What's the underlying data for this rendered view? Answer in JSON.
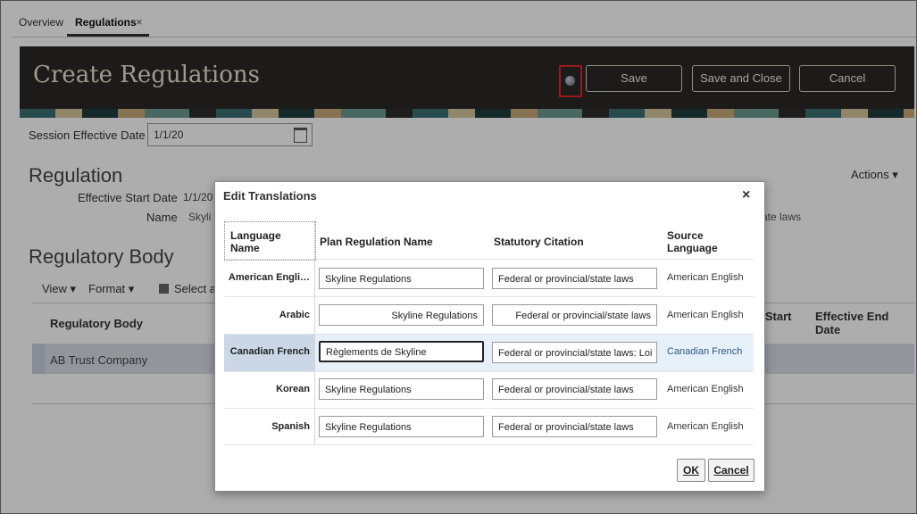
{
  "tabs": [
    {
      "label": "Overview"
    },
    {
      "label": "Regulations"
    }
  ],
  "header": {
    "title": "Create Regulations",
    "buttons": {
      "save": "Save",
      "save_close": "Save and Close",
      "cancel": "Cancel"
    },
    "highlight_icon": "translation-globe-icon"
  },
  "session": {
    "label": "Session Effective Date",
    "value": "1/1/20"
  },
  "regulation": {
    "title": "Regulation",
    "actions": "Actions ▾",
    "effective_start_label": "Effective Start Date",
    "effective_start_value": "1/1/20",
    "name_label": "Name",
    "name_value_partial": "Skyli",
    "statutory_partial": "ate laws"
  },
  "regulatory_body": {
    "title": "Regulatory Body",
    "toolbar": {
      "view": "View ▾",
      "format": "Format ▾",
      "select": "Select a"
    },
    "columns": {
      "body": "Regulatory Body",
      "eff_start": "e Start",
      "eff_end": "Effective End Date"
    },
    "row": "AB Trust Company"
  },
  "dialog": {
    "title": "Edit Translations",
    "close": "×",
    "columns": {
      "language": "Language Name",
      "plan_name": "Plan Regulation Name",
      "statutory": "Statutory Citation",
      "source": "Source Language"
    },
    "rows": [
      {
        "language": "American Engli…",
        "plan_name": "Skyline Regulations",
        "statutory": "Federal or provincial/state laws",
        "source": "American English"
      },
      {
        "language": "Arabic",
        "plan_name": "Skyline Regulations",
        "statutory": "Federal or provincial/state laws",
        "source": "American English"
      },
      {
        "language": "Canadian French",
        "plan_name": "Règlements de Skyline",
        "statutory": "Federal or provincial/state laws: Loi",
        "source": "Canadian French"
      },
      {
        "language": "Korean",
        "plan_name": "Skyline Regulations",
        "statutory": "Federal or provincial/state laws",
        "source": "American English"
      },
      {
        "language": "Spanish",
        "plan_name": "Skyline Regulations",
        "statutory": "Federal or provincial/state laws",
        "source": "American English"
      }
    ],
    "buttons": {
      "ok": "OK",
      "cancel": "Cancel"
    }
  }
}
